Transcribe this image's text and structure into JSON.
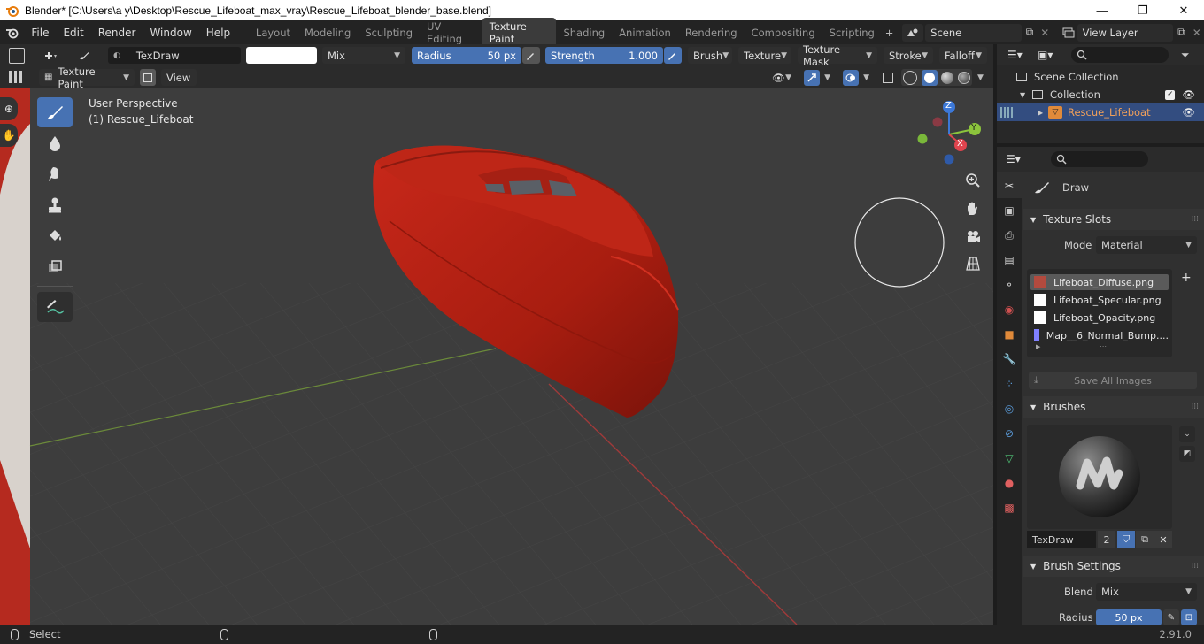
{
  "window": {
    "title": "Blender* [C:\\Users\\a y\\Desktop\\Rescue_Lifeboat_max_vray\\Rescue_Lifeboat_blender_base.blend]",
    "minimize": "—",
    "maximize": "❐",
    "close": "✕"
  },
  "menu": [
    "File",
    "Edit",
    "Render",
    "Window",
    "Help"
  ],
  "workspaces": [
    "Layout",
    "Modeling",
    "Sculpting",
    "UV Editing",
    "Texture Paint",
    "Shading",
    "Animation",
    "Rendering",
    "Compositing",
    "Scripting"
  ],
  "active_workspace": "Texture Paint",
  "add_workspace": "+",
  "scene": "Scene",
  "view_layer": "View Layer",
  "tool_header": {
    "brush_name": "TexDraw",
    "blend_mode": "Mix",
    "radius_label": "Radius",
    "radius_value": "50 px",
    "strength_label": "Strength",
    "strength_value": "1.000",
    "brush_menu": "Brush",
    "texture_menu": "Texture",
    "texture_mask_menu": "Texture Mask",
    "stroke_menu": "Stroke",
    "falloff_menu": "Falloff"
  },
  "viewport_header": {
    "mode": "Texture Paint",
    "view_menu": "View"
  },
  "viewport": {
    "perspective": "User Perspective",
    "object_label": "(1) Rescue_Lifeboat",
    "gizmo": {
      "x": "X",
      "y": "Y",
      "z": "Z"
    },
    "colors": {
      "x_axis": "#e0444e",
      "y_axis": "#8cc43c",
      "z_axis": "#3c78d8",
      "boat": "#b31f10"
    }
  },
  "outliner": {
    "scene_collection": "Scene Collection",
    "collection": "Collection",
    "object": "Rescue_Lifeboat"
  },
  "properties": {
    "active_tool": "Draw",
    "texture_slots": {
      "header": "Texture Slots",
      "mode_label": "Mode",
      "mode_value": "Material",
      "slots": [
        {
          "name": "Lifeboat_Diffuse.png",
          "color": "#b34a3e"
        },
        {
          "name": "Lifeboat_Specular.png",
          "color": "#ffffff"
        },
        {
          "name": "Lifeboat_Opacity.png",
          "color": "#ffffff"
        },
        {
          "name": "Map__6_Normal_Bump....",
          "color": "#8080ff"
        }
      ],
      "save_all": "Save All Images"
    },
    "brushes": {
      "header": "Brushes",
      "brush_name": "TexDraw",
      "users": "2"
    },
    "brush_settings": {
      "header": "Brush Settings",
      "blend_label": "Blend",
      "blend_value": "Mix",
      "radius_label": "Radius",
      "radius_value": "50 px"
    }
  },
  "status": {
    "select": "Select",
    "version": "2.91.0"
  }
}
